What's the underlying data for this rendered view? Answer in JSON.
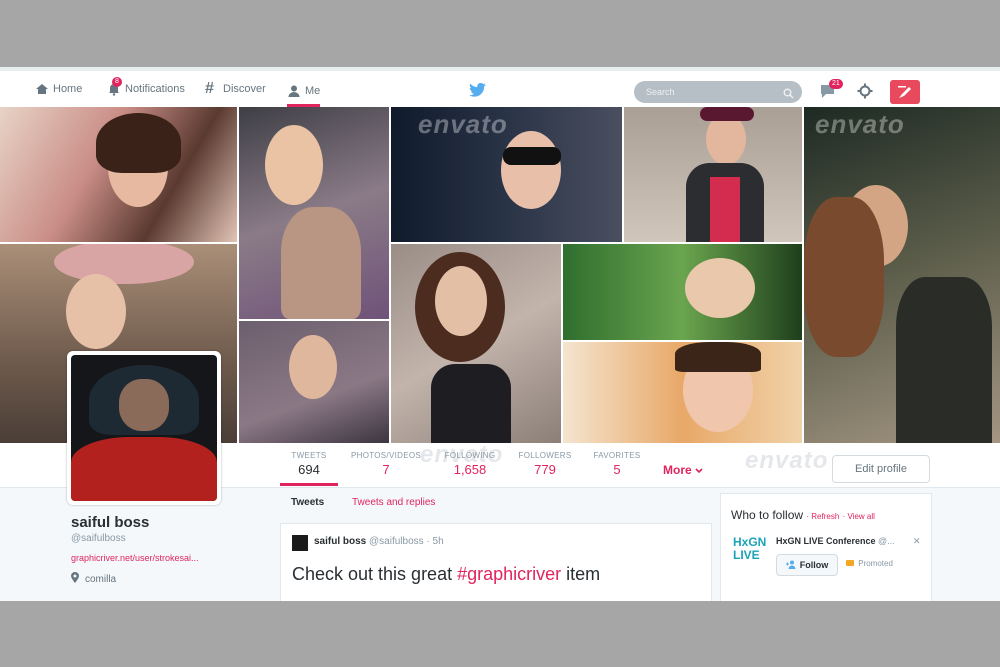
{
  "nav": {
    "items": [
      {
        "label": "Home",
        "icon": "home-icon"
      },
      {
        "label": "Notifications",
        "icon": "bell-icon",
        "badge": "8"
      },
      {
        "label": "Discover",
        "icon": "hash-icon"
      },
      {
        "label": "Me",
        "icon": "person-icon"
      }
    ],
    "search_placeholder": "Search",
    "messages_badge": "21",
    "accent": "#e0245e"
  },
  "watermark": "envato",
  "stats": [
    {
      "label": "TWEETS",
      "value": "694"
    },
    {
      "label": "PHOTOS/VIDEOS",
      "value": "7"
    },
    {
      "label": "FOLLOWING",
      "value": "1,658"
    },
    {
      "label": "FOLLOWERS",
      "value": "779"
    },
    {
      "label": "FAVORITES",
      "value": "5"
    }
  ],
  "more_label": "More",
  "edit_profile_label": "Edit profile",
  "profile": {
    "name": "saiful boss",
    "handle": "@saifulboss",
    "link": "graphicriver.net/user/strokesai...",
    "location": "comilla"
  },
  "tabs": [
    "Tweets",
    "Tweets and replies"
  ],
  "tweet": {
    "name": "saiful boss",
    "handle": "@saifulboss",
    "time": "· 5h",
    "text_before": "Check out this great ",
    "hashtag": "#graphicriver",
    "text_after": " item"
  },
  "who_to_follow": {
    "title": "Who to follow",
    "refresh": "Refresh",
    "view_all": "View all",
    "account_logo_text": "HxGN LIVE",
    "account_name": "HxGN LIVE Conference",
    "account_handle": "@...",
    "follow_label": "Follow",
    "promoted_label": "Promoted"
  }
}
